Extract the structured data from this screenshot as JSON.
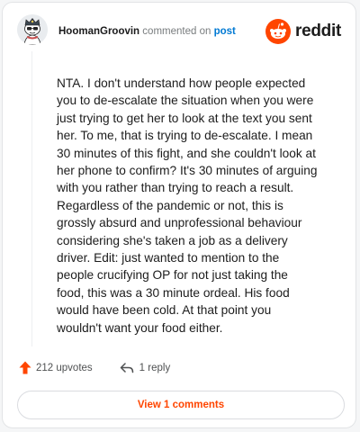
{
  "header": {
    "username": "HoomanGroovin",
    "action_text": "commented on",
    "post_link": "post"
  },
  "brand": {
    "name": "reddit",
    "icon": "reddit-snoo-icon",
    "color": "#ff4500"
  },
  "avatar": {
    "icon": "user-avatar"
  },
  "comment": {
    "body": "NTA. I don't understand how people expected you to de-escalate the situation when you were just trying to get her to look at the text you sent her. To me, that is trying to de-escalate. I mean 30 minutes of this fight, and she couldn't look at her phone to confirm? It's 30 minutes of arguing with you rather than trying to reach a result. Regardless of the pandemic or not, this is grossly absurd and unprofessional behaviour considering she's taken a job as a delivery driver. Edit: just wanted to mention to the people crucifying OP for not just taking the food, this was a 30 minute ordeal. His food would have been cold. At that point you wouldn't want your food either."
  },
  "footer": {
    "upvotes_label": "212 upvotes",
    "upvote_icon": "upvote-arrow-icon",
    "reply_label": "1 reply",
    "reply_icon": "reply-arrow-icon"
  },
  "view_button": {
    "label": "View 1 comments"
  },
  "colors": {
    "accent": "#ff4500",
    "link": "#0079d3",
    "text": "#1c1c1c",
    "muted": "#787c7e"
  }
}
